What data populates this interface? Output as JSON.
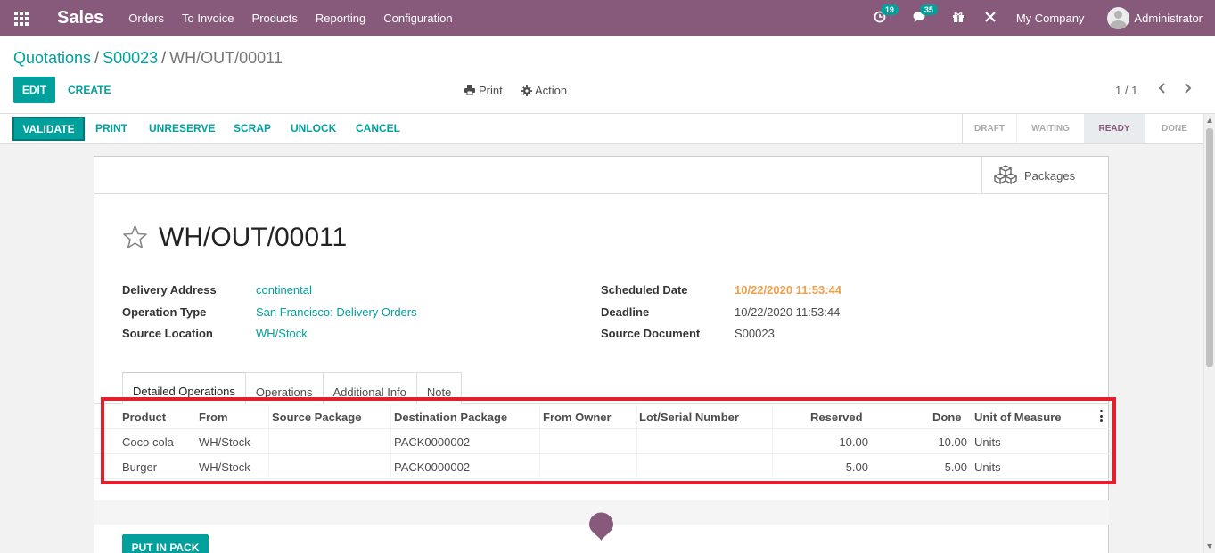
{
  "navbar": {
    "brand": "Sales",
    "menu": [
      "Orders",
      "To Invoice",
      "Products",
      "Reporting",
      "Configuration"
    ],
    "activity_count": "19",
    "messages_count": "35",
    "company": "My Company",
    "user": "Administrator"
  },
  "breadcrumb": {
    "items": [
      "Quotations",
      "S00023",
      "WH/OUT/00011"
    ]
  },
  "control": {
    "edit": "EDIT",
    "create": "CREATE",
    "print": "Print",
    "action": "Action",
    "pager": "1 / 1"
  },
  "statusbar": {
    "buttons": [
      "VALIDATE",
      "PRINT",
      "UNRESERVE",
      "SCRAP",
      "UNLOCK",
      "CANCEL"
    ],
    "stages": [
      "DRAFT",
      "WAITING",
      "READY",
      "DONE"
    ],
    "active_stage": "READY"
  },
  "sheet": {
    "packages_label": "Packages",
    "title": "WH/OUT/00011",
    "left_fields": [
      {
        "label": "Delivery Address",
        "value": "continental"
      },
      {
        "label": "Operation Type",
        "value": "San Francisco: Delivery Orders"
      },
      {
        "label": "Source Location",
        "value": "WH/Stock"
      }
    ],
    "right_fields": [
      {
        "label": "Scheduled Date",
        "value": "10/22/2020 11:53:44"
      },
      {
        "label": "Deadline",
        "value": "10/22/2020 11:53:44"
      },
      {
        "label": "Source Document",
        "value": "S00023"
      }
    ],
    "tabs": [
      "Detailed Operations",
      "Operations",
      "Additional Info",
      "Note"
    ],
    "active_tab": "Detailed Operations"
  },
  "table": {
    "columns": [
      "Product",
      "From",
      "Source Package",
      "Destination Package",
      "From Owner",
      "Lot/Serial Number",
      "Reserved",
      "Done",
      "Unit of Measure"
    ],
    "rows": [
      {
        "product": "Coco cola",
        "from": "WH/Stock",
        "source_package": "",
        "destination_package": "PACK0000002",
        "from_owner": "",
        "lot": "",
        "reserved": "10.00",
        "done": "10.00",
        "uom": "Units"
      },
      {
        "product": "Burger",
        "from": "WH/Stock",
        "source_package": "",
        "destination_package": "PACK0000002",
        "from_owner": "",
        "lot": "",
        "reserved": "5.00",
        "done": "5.00",
        "uom": "Units"
      }
    ]
  },
  "footer": {
    "put_in_pack": "PUT IN PACK"
  },
  "colors": {
    "brand": "#875a7b",
    "accent": "#00a09d",
    "highlight": "#e0212b",
    "date_warning": "#f0a04a"
  }
}
